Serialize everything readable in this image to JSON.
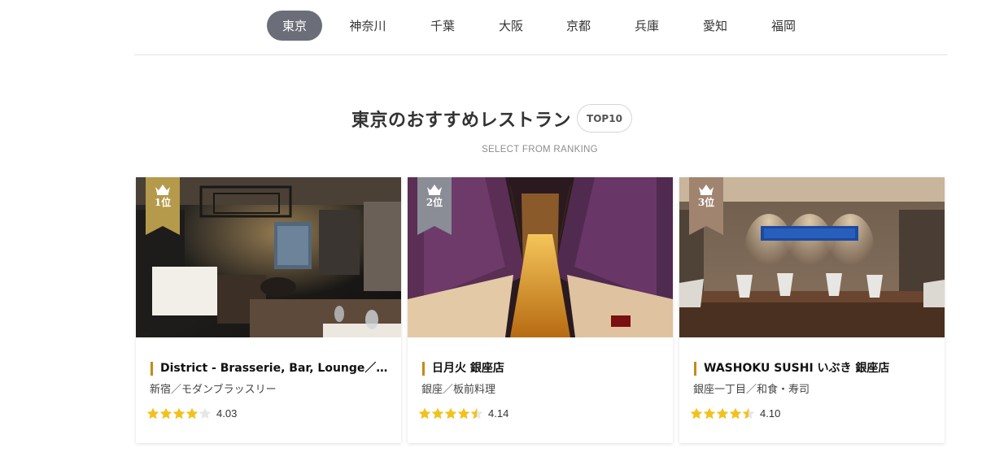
{
  "region_tabs": [
    {
      "label": "東京",
      "active": true
    },
    {
      "label": "神奈川",
      "active": false
    },
    {
      "label": "千葉",
      "active": false
    },
    {
      "label": "大阪",
      "active": false
    },
    {
      "label": "京都",
      "active": false
    },
    {
      "label": "兵庫",
      "active": false
    },
    {
      "label": "愛知",
      "active": false
    },
    {
      "label": "福岡",
      "active": false
    }
  ],
  "section": {
    "title": "東京のおすすめレストラン",
    "badge": "TOP10",
    "subtitle": "SELECT FROM RANKING"
  },
  "restaurants": [
    {
      "rank": "1位",
      "name": "District - Brasserie, Bar, Lounge／Aloft Tokyo Ginza",
      "genre": "新宿／モダンブラッスリー",
      "rating": 4.03,
      "rating_text": "4.03",
      "ribbon_color": "#b49a4a"
    },
    {
      "rank": "2位",
      "name": "日月火 銀座店",
      "genre": "銀座／板前料理",
      "rating": 4.14,
      "rating_text": "4.14",
      "ribbon_color": "#8a8c96"
    },
    {
      "rank": "3位",
      "name": "WASHOKU SUSHI いぶき 銀座店",
      "genre": "銀座一丁目／和食・寿司",
      "rating": 4.1,
      "rating_text": "4.10",
      "ribbon_color": "#a08470"
    }
  ],
  "colors": {
    "accent_bar": "#c58a17",
    "star": "#f2c21b",
    "active_tab": "#6b6e78"
  }
}
